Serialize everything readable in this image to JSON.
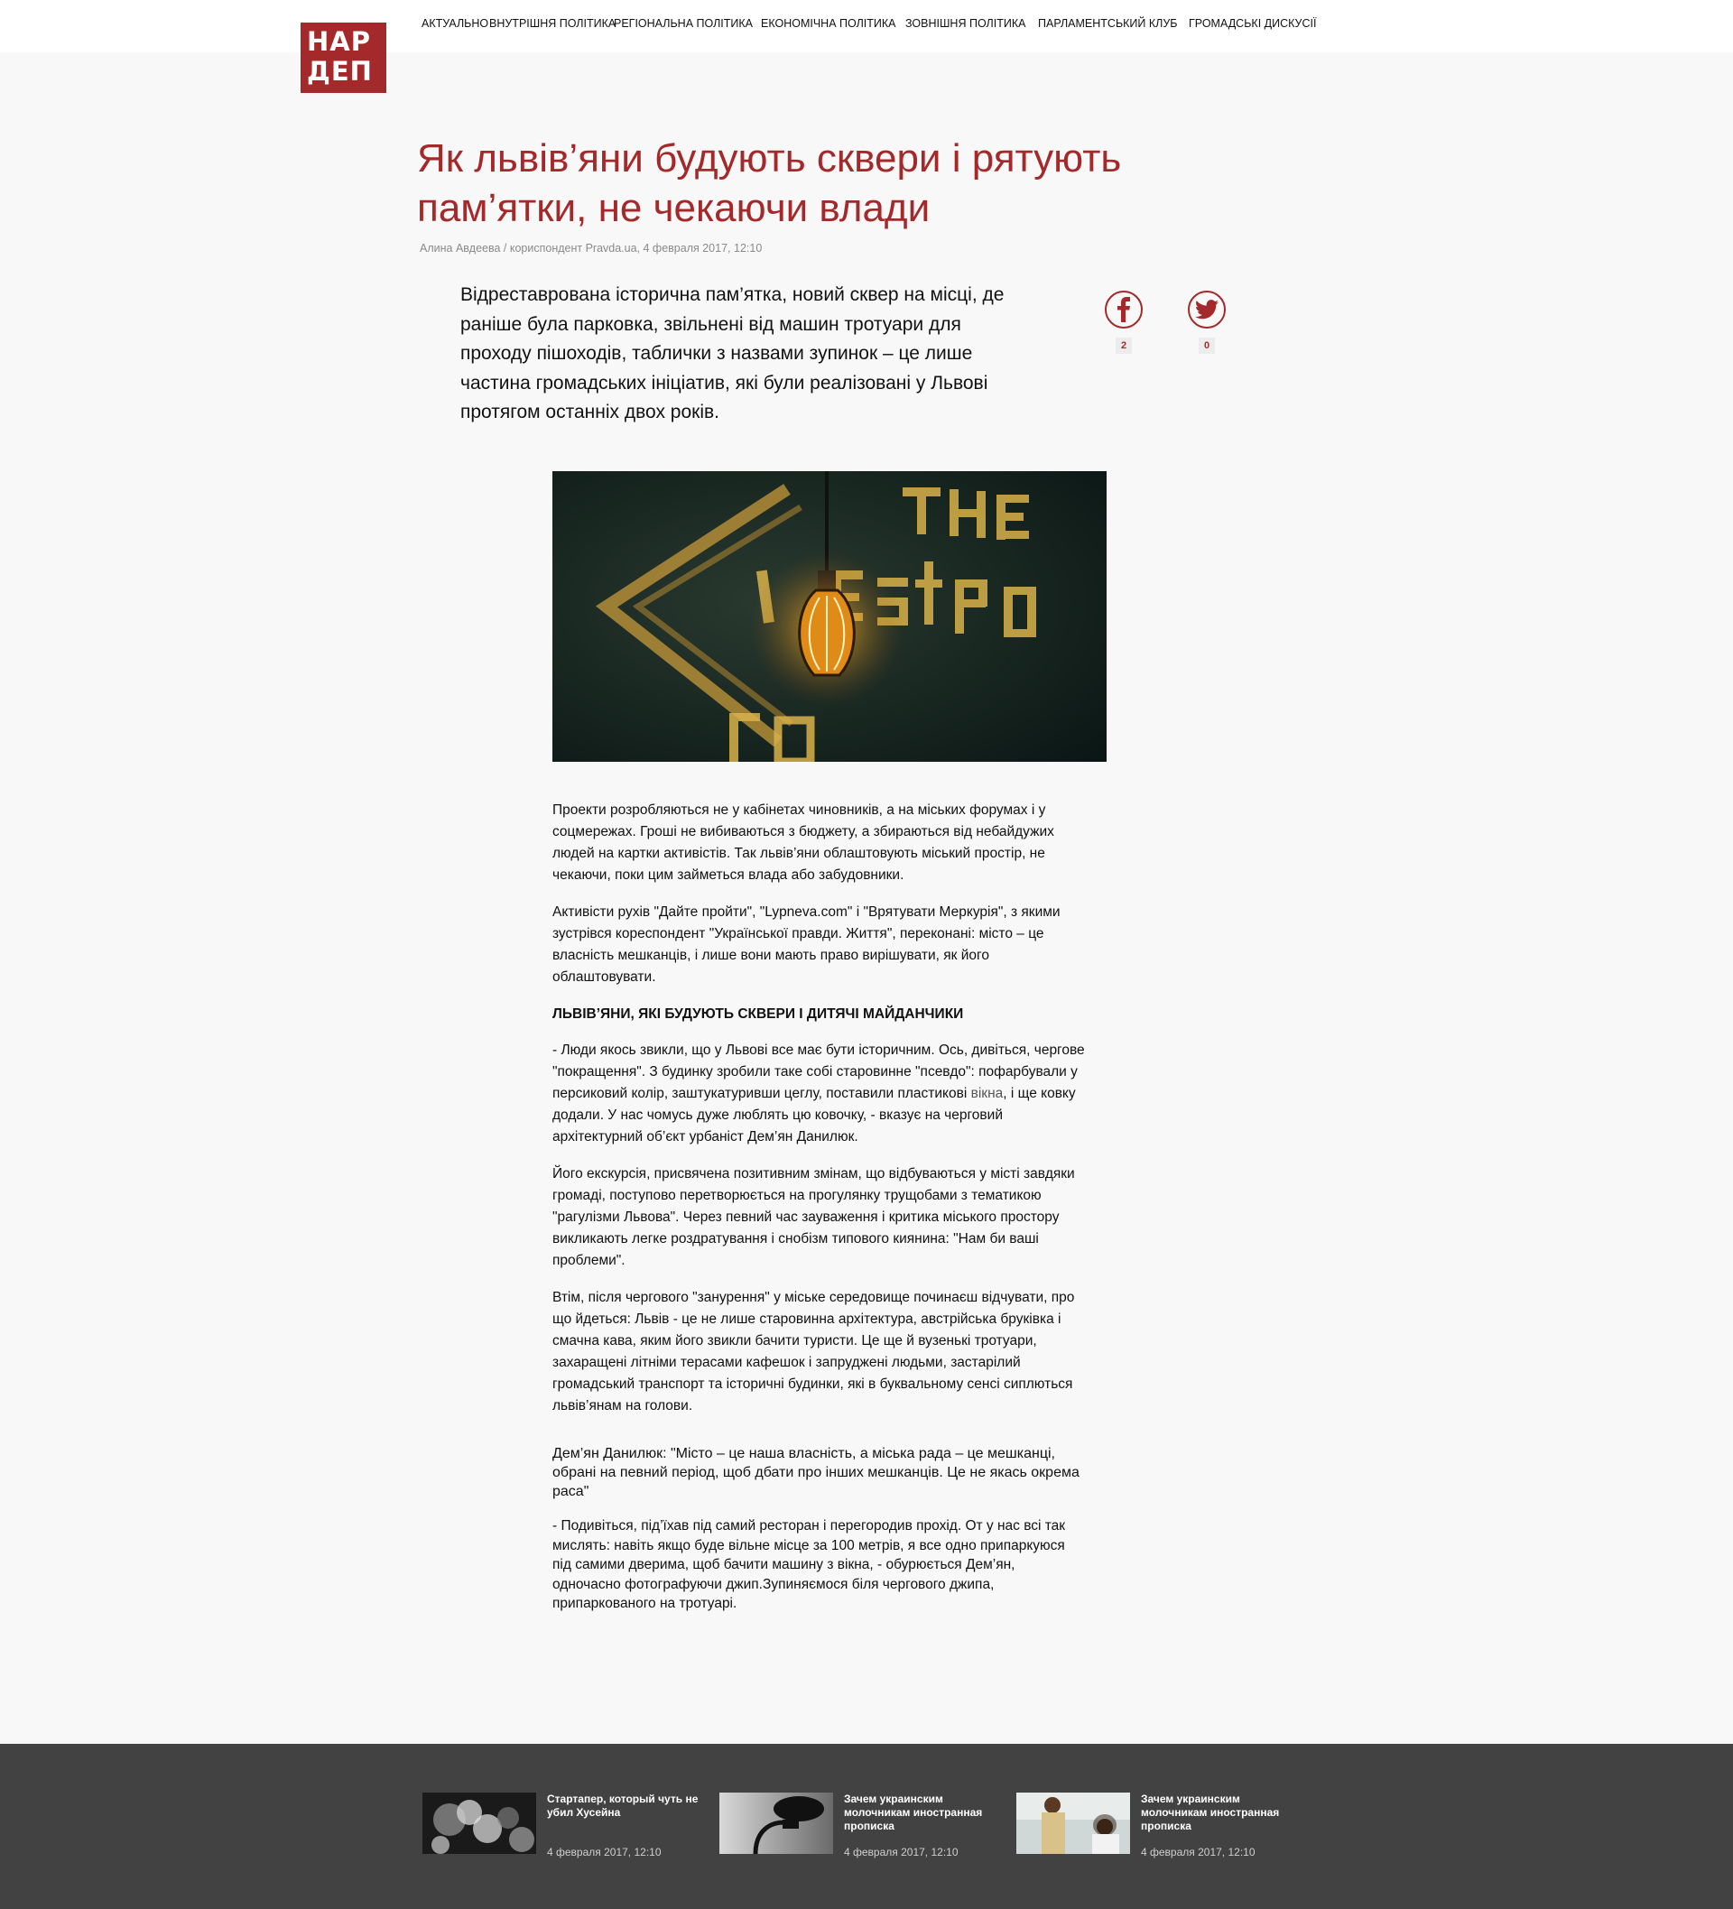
{
  "brand": {
    "logo_line1": "НАР",
    "logo_line2": "ДЕП",
    "accent_color": "#a3292a"
  },
  "nav": {
    "items": [
      {
        "label": "Актуально"
      },
      {
        "label": "Внутрішня політика"
      },
      {
        "label": "Регіональна політика"
      },
      {
        "label": "Економічна політика"
      },
      {
        "label": "Зовнішня політика"
      },
      {
        "label": "Парламентський клуб"
      },
      {
        "label": "Громадські дискусії"
      }
    ]
  },
  "article": {
    "title": "Як львів’яни будують сквери і рятують пам’ятки, не чекаючи влади",
    "byline": "Алина Авдеева / кориспондент Pravda.ua, 4 февраля 2017, 12:10",
    "lead": "Відреставрована історична пам’ятка, новий сквер на місці, де раніше була парковка, звільнені від машин тротуари для проходу пішоходів, таблички з назвами зупинок – це лише частина громадських ініціатив, які були реалізовані у Львові протягом останніх двох років.",
    "share": {
      "facebook_icon": "facebook-icon",
      "facebook_count": "2",
      "twitter_icon": "twitter-icon",
      "twitter_count": "0"
    },
    "paragraph1": "Проекти розробляються не у кабінетах чиновників, а на міських форумах і у соцмережах. Гроші не вибиваються з бюджету, а збираються від небайдужих людей на картки активістів. Так львів’яни облаштовують міський простір, не чекаючи, поки цим займеться влада або забудовники.",
    "paragraph2": "Активісти рухів \"Дайте пройти\", \"Lypneva.com\" і \"Врятувати Меркурія\", з якими зустрівся кореспондент \"Української правди. Життя\", переконані: місто – це власність мешканців, і лише вони мають право вирішувати, як його облаштовувати.",
    "subheading": "Львів’яни, які будують сквери і дитячі майданчики",
    "paragraph3_a": "- Люди якось звикли, що у Львові все має бути історичним. Ось, дивіться, чергове \"покращення\". З будинку зробили таке собі старовинне \"псевдо\": пофарбували у персиковий колір, заштукатуривши цеглу, поставили пластикові ",
    "paragraph3_link": "вікна",
    "paragraph3_b": ", і ще ковку додали. У нас чомусь дуже люблять цю ковочку, - вказує на черговий архітектурний об’єкт урбаніст Дем’ян Данилюк.",
    "paragraph4": "Його екскурсія, присвячена позитивним змінам, що відбуваються у місті завдяки громаді, поступово перетворюється на прогулянку трущобами з тематикою \"рагулізми Львова\". Через певний час зауваження і критика міського простору викликають легке роздратування і снобізм типового киянина: \"Нам би ваші проблеми\".",
    "paragraph5": "Втім, після чергового \"занурення\" у міське середовище починаєш відчувати, про що йдеться:  Львів - це не лише старовинна архітектура, австрійська бруківка і смачна кава, яким його звикли бачити туристи. Це ще й вузенькі тротуари, захаращені літніми терасами кафешок і запруджені людьми, застарілий громадський транспорт та історичні будинки, які в буквальному сенсі сиплються львів’янам на голови.",
    "quote": "Дем’ян Данилюк: \"Місто – це наша власність, а міська рада – це мешканці, обрані на певний період, щоб дбати про інших мешканців. Це не якась окрема раса\"",
    "paragraph6": "- Подивіться, під’їхав під самий ресторан і перегородив прохід. От у нас всі так мислять: навіть якщо буде вільне місце за 100 метрів, я все одно припаркуюся під самими дверима, щоб бачити машину з вікна, - обурюється Дем’ян, одночасно фотографуючи джип.Зупиняємося біля чергового джипа, припаркованого на тротуарі."
  },
  "footer": {
    "cards": [
      {
        "title": "Стартапер, который чуть не убил Хусейна",
        "date": "4 февраля 2017, 12:10"
      },
      {
        "title": "Зачем украинским молочникам иностранная прописка",
        "date": "4 февраля 2017, 12:10"
      },
      {
        "title": "Зачем украинским молочникам иностранная прописка",
        "date": "4 февраля 2017, 12:10"
      }
    ]
  }
}
